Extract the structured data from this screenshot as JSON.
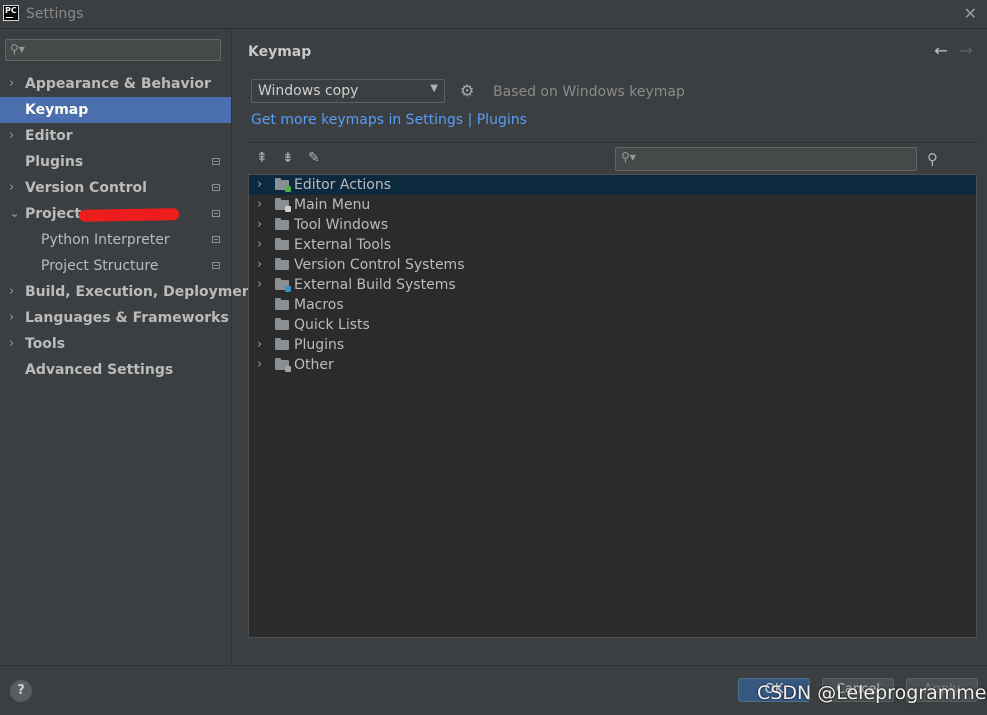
{
  "window": {
    "title": "Settings",
    "close_glyph": "✕"
  },
  "sidebar": {
    "search_placeholder": "",
    "items": [
      {
        "label": "Appearance & Behavior",
        "expandable": true,
        "bold": true
      },
      {
        "label": "Keymap",
        "expandable": false,
        "bold": true,
        "selected": true
      },
      {
        "label": "Editor",
        "expandable": true,
        "bold": true
      },
      {
        "label": "Plugins",
        "expandable": false,
        "bold": true,
        "modified": true
      },
      {
        "label": "Version Control",
        "expandable": true,
        "bold": true,
        "modified": true
      },
      {
        "label": "Project:",
        "expandable": true,
        "expanded": true,
        "bold": true,
        "modified": true,
        "redacted": true
      },
      {
        "label": "Python Interpreter",
        "child": true,
        "modified": true
      },
      {
        "label": "Project Structure",
        "child": true,
        "modified": true
      },
      {
        "label": "Build, Execution, Deployment",
        "expandable": true,
        "bold": true
      },
      {
        "label": "Languages & Frameworks",
        "expandable": true,
        "bold": true
      },
      {
        "label": "Tools",
        "expandable": true,
        "bold": true
      },
      {
        "label": "Advanced Settings",
        "expandable": false,
        "bold": true
      }
    ]
  },
  "main": {
    "breadcrumb": "Keymap",
    "keymap_select": {
      "value": "Windows copy"
    },
    "based_on": "Based on Windows keymap",
    "links": {
      "get_more": "Get more keymaps in Settings",
      "separator": "|",
      "plugins": "Plugins"
    },
    "search_placeholder": "",
    "tree": [
      {
        "label": "Editor Actions",
        "expandable": true,
        "selected": true,
        "badge": "#4caf50"
      },
      {
        "label": "Main Menu",
        "expandable": true,
        "badge": "#cfcfcf"
      },
      {
        "label": "Tool Windows",
        "expandable": true
      },
      {
        "label": "External Tools",
        "expandable": true
      },
      {
        "label": "Version Control Systems",
        "expandable": true
      },
      {
        "label": "External Build Systems",
        "expandable": true,
        "badge": "#3592c4"
      },
      {
        "label": "Macros",
        "expandable": false
      },
      {
        "label": "Quick Lists",
        "expandable": false
      },
      {
        "label": "Plugins",
        "expandable": true
      },
      {
        "label": "Other",
        "expandable": true,
        "badge": "#9aa7b0"
      }
    ]
  },
  "footer": {
    "help": "?",
    "ok": "OK",
    "cancel": "Cancel",
    "apply": "Apply",
    "watermark": "CSDN @Leleprogrammer"
  },
  "colors": {
    "accent": "#4b6eaf",
    "link": "#589df6",
    "tree_selection": "#0d293e"
  }
}
